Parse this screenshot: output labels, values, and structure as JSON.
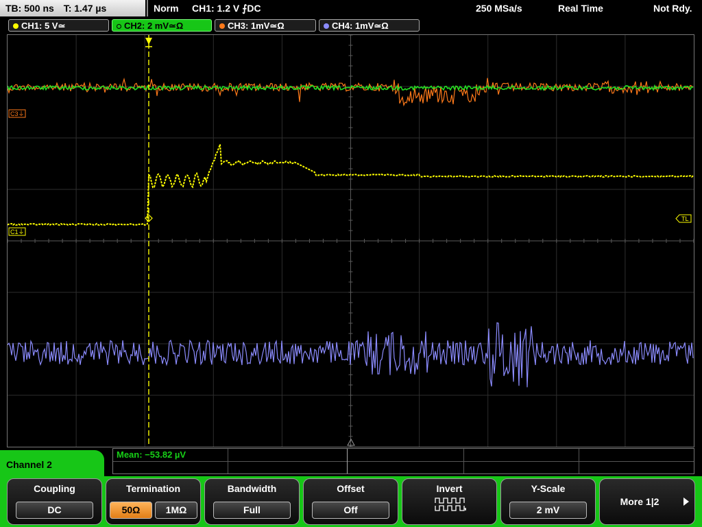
{
  "status_bar": {
    "timebase": "TB: 500 ns",
    "trigger_time": "T: 1.47 µs",
    "trigger_mode": "Norm",
    "trigger_setting": "CH1: 1.2 V ⨍DC",
    "sample_rate": "250 MSa/s",
    "acquisition_mode": "Real Time",
    "ready_state": "Not Rdy."
  },
  "channel_tabs": [
    {
      "label": "CH1: 5 V≃",
      "color": "#ffff00",
      "active": false
    },
    {
      "label": "CH2: 2 mV≃Ω",
      "color": "#17c617",
      "active": true
    },
    {
      "label": "CH3: 1mV≃Ω",
      "color": "#ff7a1a",
      "active": false
    },
    {
      "label": "CH4: 1mV≃Ω",
      "color": "#8c8cff",
      "active": false
    }
  ],
  "markers": {
    "c3": "C3⏚",
    "c1": "C1⏚",
    "trigger_level": "TL"
  },
  "waveform_colors": {
    "ch1": "#ffff00",
    "ch2": "#22e022",
    "ch3": "#ff7a1a",
    "ch4": "#8c8cff",
    "trigger": "#ffff00"
  },
  "measurement": {
    "text": "Mean: −53.82 µV"
  },
  "menu": {
    "title": "Channel 2",
    "coupling": {
      "label": "Coupling",
      "value": "DC"
    },
    "termination": {
      "label": "Termination",
      "options": [
        {
          "label": "50Ω",
          "selected": true
        },
        {
          "label": "1MΩ",
          "selected": false
        }
      ]
    },
    "bandwidth": {
      "label": "Bandwidth",
      "value": "Full"
    },
    "offset": {
      "label": "Offset",
      "value": "Off"
    },
    "invert": {
      "label": "Invert",
      "icon": "invert-waveform-icon"
    },
    "yscale": {
      "label": "Y-Scale",
      "value": "2 mV"
    },
    "more": {
      "label": "More 1|2",
      "icon": "arrow-right-icon"
    }
  }
}
